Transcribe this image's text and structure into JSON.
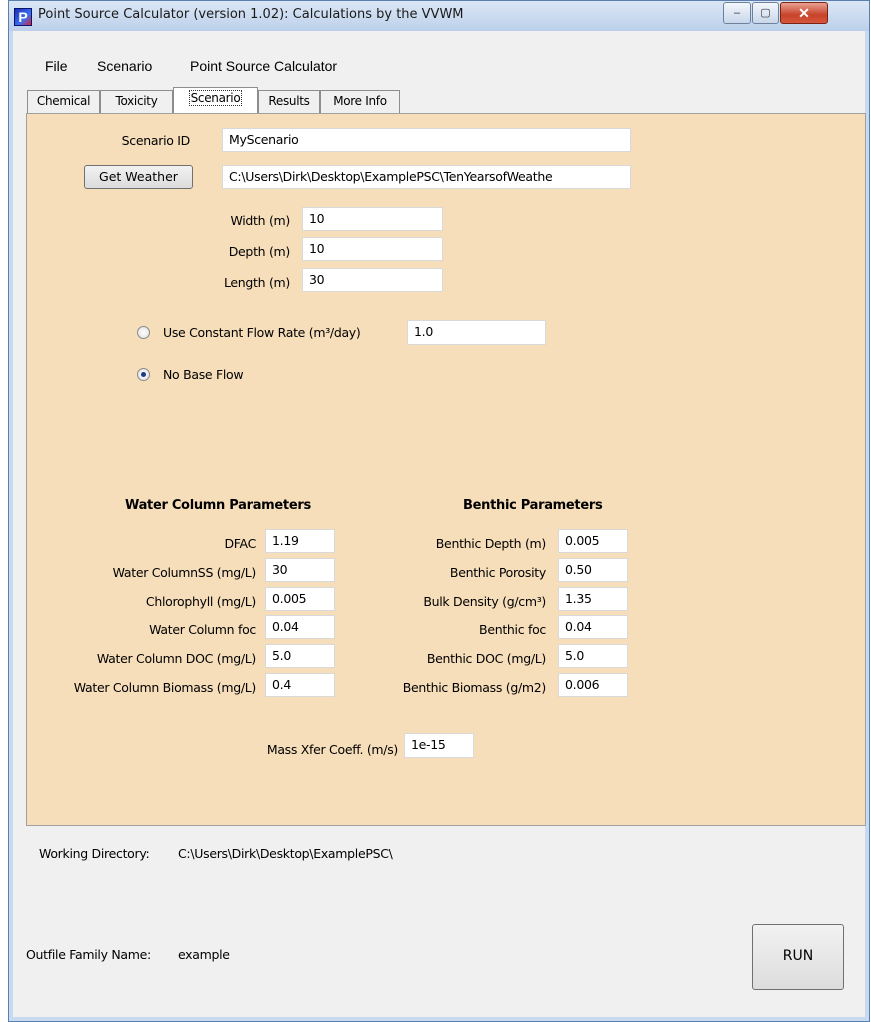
{
  "window": {
    "title": "Point Source Calculator (version 1.02): Calculations by the VVWM",
    "app_icon_letter": "P",
    "controls": {
      "minimize": "‒",
      "maximize": "▢",
      "close": "✕"
    }
  },
  "menu": [
    "File",
    "Scenario",
    "Point Source Calculator"
  ],
  "tabs": [
    {
      "label": "Chemical",
      "active": false
    },
    {
      "label": "Toxicity",
      "active": false
    },
    {
      "label": "Scenario",
      "active": true
    },
    {
      "label": "Results",
      "active": false
    },
    {
      "label": "More Info",
      "active": false
    }
  ],
  "scenario": {
    "scenario_id_label": "Scenario ID",
    "scenario_id_value": "MyScenario",
    "get_weather_label": "Get Weather",
    "weather_path": "C:\\Users\\Dirk\\Desktop\\ExamplePSC\\TenYearsofWeathe",
    "width_label": "Width (m)",
    "width_value": "10",
    "depth_label": "Depth (m)",
    "depth_value": "10",
    "length_label": "Length (m)",
    "length_value": "30",
    "constant_flow_label": "Use Constant Flow Rate (m³/day)",
    "constant_flow_value": "1.0",
    "constant_flow_selected": false,
    "no_base_flow_label": "No Base Flow",
    "no_base_flow_selected": true
  },
  "water_column": {
    "header": "Water Column Parameters",
    "params": [
      {
        "label": "DFAC",
        "value": "1.19"
      },
      {
        "label": "Water ColumnSS (mg/L)",
        "value": "30"
      },
      {
        "label": "Chlorophyll (mg/L)",
        "value": "0.005"
      },
      {
        "label": "Water Column foc",
        "value": "0.04"
      },
      {
        "label": "Water Column DOC (mg/L)",
        "value": "5.0"
      },
      {
        "label": "Water Column Biomass (mg/L)",
        "value": "0.4"
      }
    ]
  },
  "benthic": {
    "header": "Benthic Parameters",
    "params": [
      {
        "label": "Benthic Depth (m)",
        "value": "0.005"
      },
      {
        "label": "Benthic Porosity",
        "value": "0.50"
      },
      {
        "label": "Bulk Density (g/cm³)",
        "value": "1.35"
      },
      {
        "label": "Benthic foc",
        "value": "0.04"
      },
      {
        "label": "Benthic DOC (mg/L)",
        "value": "5.0"
      },
      {
        "label": "Benthic Biomass (g/m2)",
        "value": "0.006"
      }
    ]
  },
  "mass_xfer": {
    "label": "Mass Xfer Coeff. (m/s)",
    "value": "1e-15"
  },
  "status": {
    "working_dir_label": "Working Directory:",
    "working_dir_value": "C:\\Users\\Dirk\\Desktop\\ExamplePSC\\",
    "outfile_label": "Outfile Family Name:",
    "outfile_value": "example",
    "run_label": "RUN"
  }
}
